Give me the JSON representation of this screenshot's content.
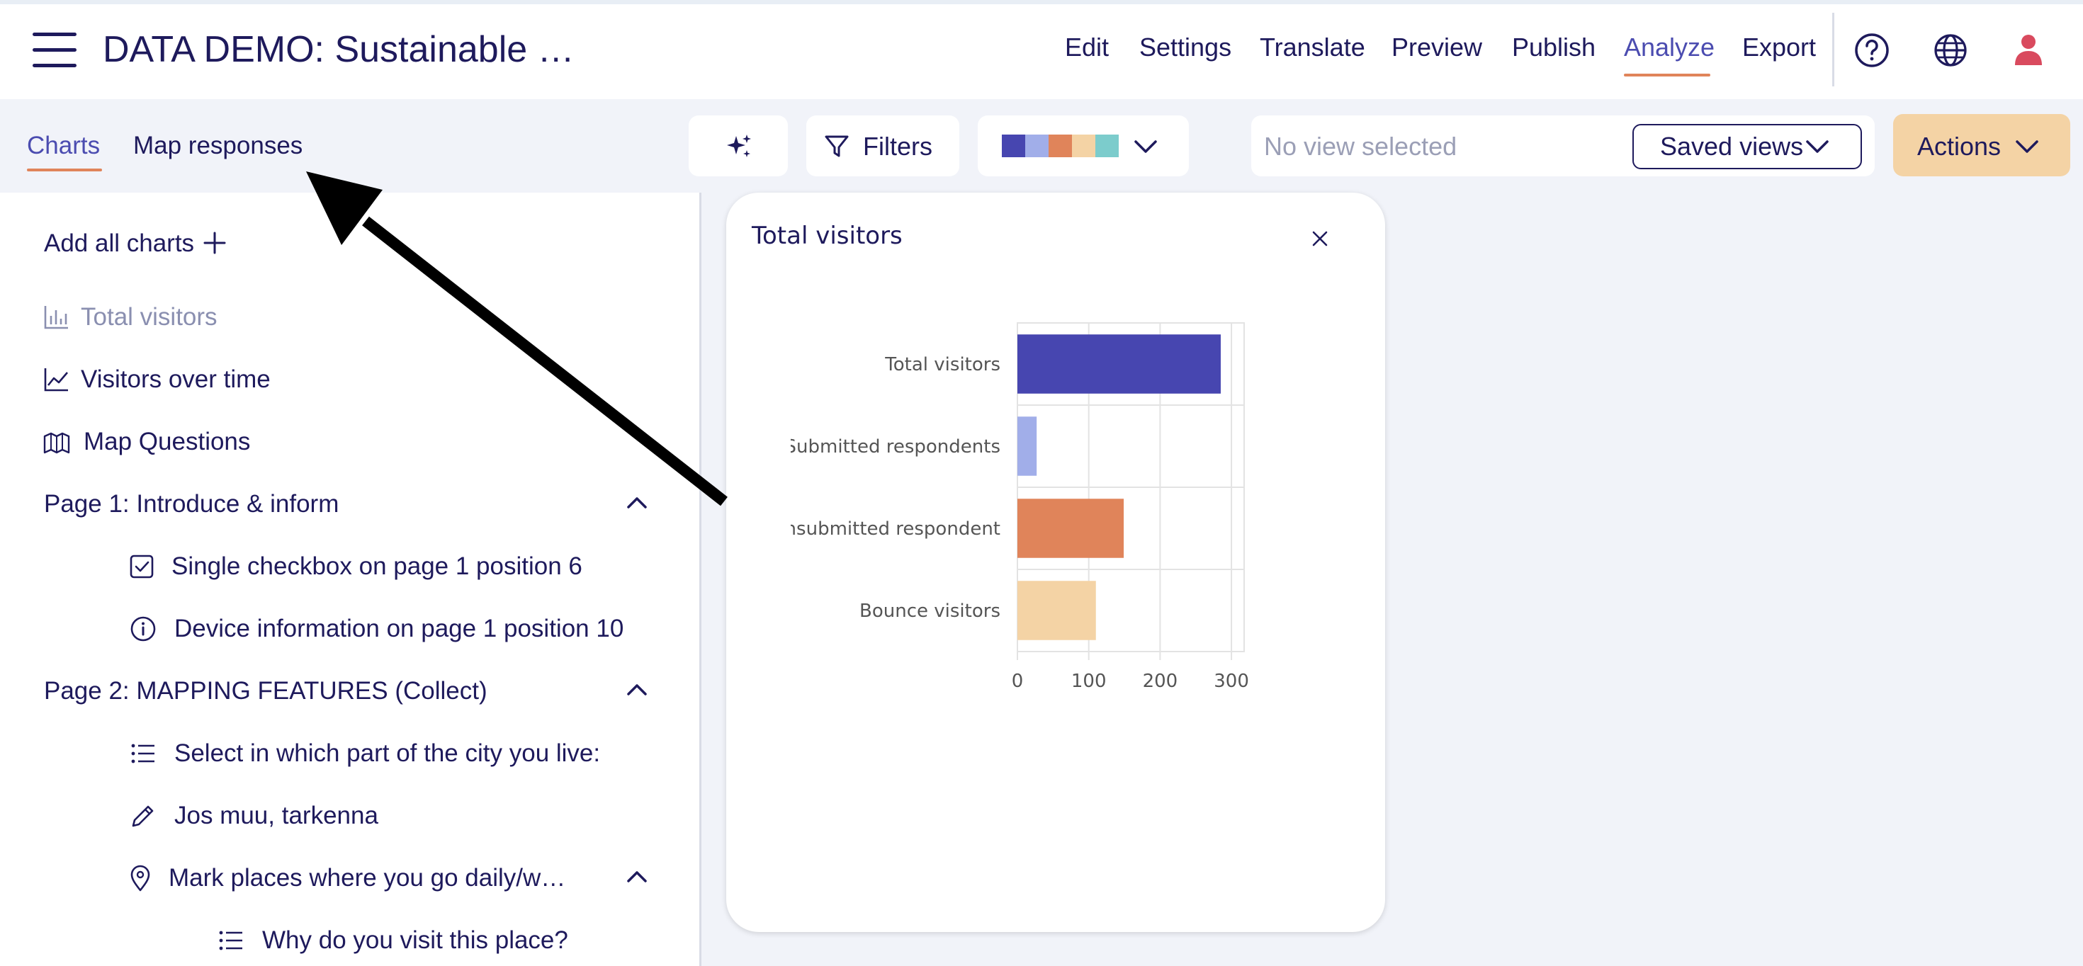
{
  "header": {
    "title": "DATA DEMO: Sustainable …",
    "nav": [
      "Edit",
      "Settings",
      "Translate",
      "Preview",
      "Publish",
      "Analyze",
      "Export"
    ],
    "active_nav": "Analyze",
    "icons": [
      "help-icon",
      "globe-icon",
      "user-icon"
    ]
  },
  "tabs": {
    "charts": "Charts",
    "map_responses": "Map responses",
    "active": "Charts"
  },
  "toolbar": {
    "ai_icon": "sparkles-icon",
    "filters_label": "Filters",
    "palette": [
      "#4746b0",
      "#a1aee9",
      "#e0845a",
      "#f4d3a5",
      "#7ccccc"
    ],
    "view_placeholder": "No view selected",
    "saved_views_label": "Saved views",
    "actions_label": "Actions"
  },
  "sidebar": {
    "add_all": "Add all charts",
    "items": [
      {
        "label": "Total visitors",
        "icon": "bar-chart-icon"
      },
      {
        "label": "Visitors over time",
        "icon": "line-chart-icon"
      },
      {
        "label": "Map Questions",
        "icon": "map-icon"
      }
    ],
    "page1": {
      "title": "Page 1: Introduce & inform",
      "items": [
        {
          "label": "Single checkbox on page 1 position 6",
          "icon": "checkbox-icon"
        },
        {
          "label": "Device information on page 1 position 10",
          "icon": "info-icon"
        }
      ]
    },
    "page2": {
      "title": "Page 2: MAPPING FEATURES (Collect)",
      "items": [
        {
          "label": "Select in which part of the city you live:",
          "icon": "list-icon"
        },
        {
          "label": "Jos muu, tarkenna",
          "icon": "pencil-icon"
        },
        {
          "label": "Mark places where you go daily/w…",
          "icon": "map-pin-icon"
        }
      ],
      "sub_items": [
        {
          "label": "Why do you visit this place?",
          "icon": "list-icon"
        }
      ]
    }
  },
  "card": {
    "title": "Total visitors"
  },
  "colors": {
    "accent": "#4b4cb0",
    "underline": "#e0845a",
    "actions_bg": "#f4d3a5",
    "text": "#1e1a5c"
  },
  "chart_data": {
    "type": "bar",
    "orientation": "horizontal",
    "title": "Total visitors",
    "categories": [
      "Total visitors",
      "Submitted respondents",
      "Unsubmitted respondents",
      "Bounce visitors"
    ],
    "category_labels": [
      "Total visitors",
      "Submitted respondents",
      "Unsubmitted respondent",
      "Bounce visitors"
    ],
    "values": [
      285,
      27,
      149,
      110
    ],
    "colors": [
      "#4746b0",
      "#a1aee9",
      "#e0845a",
      "#f4d3a5"
    ],
    "xlim": [
      0,
      300
    ],
    "xticks": [
      "0",
      "100",
      "200",
      "300"
    ],
    "grid": true
  }
}
